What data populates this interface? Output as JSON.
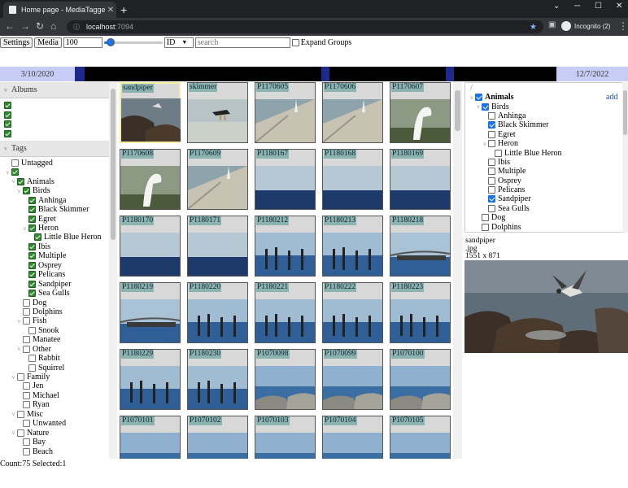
{
  "browser": {
    "tab_title": "Home page - MediaTagger",
    "new_tab": "+",
    "close_tab": "✕",
    "url_host": "localhost",
    "url_port": ":7094",
    "profile": "Incognito (2)",
    "win_min": "─",
    "win_max": "☐",
    "win_close": "✕",
    "win_chevron": "⌄"
  },
  "controls": {
    "settings_label": "Settings",
    "media_label": "Media",
    "size_value": "100",
    "slider_level": 0.1,
    "sort_value": "ID",
    "search_placeholder": "search",
    "expand_groups_label": "Expand Groups"
  },
  "timeline": {
    "start_date": "3/10/2020",
    "end_date": "12/7/2022"
  },
  "albums": {
    "title": "Albums",
    "count": 4
  },
  "tags": {
    "title": "Tags",
    "items": [
      {
        "label": "Untagged",
        "level": 0,
        "box": "empty",
        "twisty": ""
      },
      {
        "label": "",
        "level": 0,
        "box": "green",
        "twisty": "v"
      },
      {
        "label": "Animals",
        "level": 1,
        "box": "green",
        "twisty": "v"
      },
      {
        "label": "Birds",
        "level": 2,
        "box": "green",
        "twisty": "v"
      },
      {
        "label": "Anhinga",
        "level": 3,
        "box": "green",
        "twisty": ""
      },
      {
        "label": "Black Skimmer",
        "level": 3,
        "box": "green",
        "twisty": ""
      },
      {
        "label": "Egret",
        "level": 3,
        "box": "green",
        "twisty": ""
      },
      {
        "label": "Heron",
        "level": 3,
        "box": "green",
        "twisty": "v"
      },
      {
        "label": "Little Blue Heron",
        "level": 4,
        "box": "green",
        "twisty": ""
      },
      {
        "label": "Ibis",
        "level": 3,
        "box": "green",
        "twisty": ""
      },
      {
        "label": "Multiple",
        "level": 3,
        "box": "green",
        "twisty": ""
      },
      {
        "label": "Osprey",
        "level": 3,
        "box": "green",
        "twisty": ""
      },
      {
        "label": "Pelicans",
        "level": 3,
        "box": "green",
        "twisty": ""
      },
      {
        "label": "Sandpiper",
        "level": 3,
        "box": "green",
        "twisty": ""
      },
      {
        "label": "Sea Gulls",
        "level": 3,
        "box": "green",
        "twisty": ""
      },
      {
        "label": "Dog",
        "level": 2,
        "box": "empty",
        "twisty": ""
      },
      {
        "label": "Dolphins",
        "level": 2,
        "box": "empty",
        "twisty": ""
      },
      {
        "label": "Fish",
        "level": 2,
        "box": "empty",
        "twisty": "v"
      },
      {
        "label": "Snook",
        "level": 3,
        "box": "empty",
        "twisty": ""
      },
      {
        "label": "Manatee",
        "level": 2,
        "box": "empty",
        "twisty": ""
      },
      {
        "label": "Other",
        "level": 2,
        "box": "empty",
        "twisty": "v"
      },
      {
        "label": "Rabbit",
        "level": 3,
        "box": "empty",
        "twisty": ""
      },
      {
        "label": "Squirrel",
        "level": 3,
        "box": "empty",
        "twisty": ""
      },
      {
        "label": "Family",
        "level": 1,
        "box": "empty",
        "twisty": "v"
      },
      {
        "label": "Jen",
        "level": 2,
        "box": "empty",
        "twisty": ""
      },
      {
        "label": "Michael",
        "level": 2,
        "box": "empty",
        "twisty": ""
      },
      {
        "label": "Ryan",
        "level": 2,
        "box": "empty",
        "twisty": ""
      },
      {
        "label": "Misc",
        "level": 1,
        "box": "empty",
        "twisty": "v"
      },
      {
        "label": "Unwanted",
        "level": 2,
        "box": "empty",
        "twisty": ""
      },
      {
        "label": "Nature",
        "level": 1,
        "box": "empty",
        "twisty": "v"
      },
      {
        "label": "Bay",
        "level": 2,
        "box": "empty",
        "twisty": ""
      },
      {
        "label": "Beach",
        "level": 2,
        "box": "empty",
        "twisty": ""
      }
    ]
  },
  "thumbnails": [
    {
      "label": "sandpiper",
      "scene": "rocks",
      "selected": true
    },
    {
      "label": "skimmer",
      "scene": "sand",
      "selected": false
    },
    {
      "label": "P1170605",
      "scene": "wall",
      "selected": false
    },
    {
      "label": "P1170606",
      "scene": "wall",
      "selected": false
    },
    {
      "label": "P1170607",
      "scene": "egret",
      "selected": false
    },
    {
      "label": "P1170608",
      "scene": "egret",
      "selected": false
    },
    {
      "label": "P1170609",
      "scene": "wall",
      "selected": false
    },
    {
      "label": "P1180167",
      "scene": "sea",
      "selected": false
    },
    {
      "label": "P1180168",
      "scene": "sea",
      "selected": false
    },
    {
      "label": "P1180169",
      "scene": "sea",
      "selected": false
    },
    {
      "label": "P1180170",
      "scene": "sea",
      "selected": false
    },
    {
      "label": "P1180171",
      "scene": "sea",
      "selected": false
    },
    {
      "label": "P1180212",
      "scene": "pilings",
      "selected": false
    },
    {
      "label": "P1180213",
      "scene": "pilings",
      "selected": false
    },
    {
      "label": "P1180218",
      "scene": "bridge",
      "selected": false
    },
    {
      "label": "P1180219",
      "scene": "bridge",
      "selected": false
    },
    {
      "label": "P1180220",
      "scene": "pilings",
      "selected": false
    },
    {
      "label": "P1180221",
      "scene": "pilings",
      "selected": false
    },
    {
      "label": "P1180222",
      "scene": "pilings",
      "selected": false
    },
    {
      "label": "P1180223",
      "scene": "pilings",
      "selected": false
    },
    {
      "label": "P1180229",
      "scene": "pilings",
      "selected": false
    },
    {
      "label": "P1180230",
      "scene": "pilings",
      "selected": false
    },
    {
      "label": "P1070098",
      "scene": "rocksea",
      "selected": false
    },
    {
      "label": "P1070099",
      "scene": "rocksea",
      "selected": false
    },
    {
      "label": "P1070100",
      "scene": "rocksea",
      "selected": false
    },
    {
      "label": "P1070101",
      "scene": "rocksea",
      "selected": false
    },
    {
      "label": "P1070102",
      "scene": "rocksea",
      "selected": false
    },
    {
      "label": "P1070103",
      "scene": "rocksea",
      "selected": false
    },
    {
      "label": "P1070104",
      "scene": "rocksea",
      "selected": false
    },
    {
      "label": "P1070105",
      "scene": "rocksea",
      "selected": false
    }
  ],
  "tag_tree": {
    "root": "/",
    "add_label": "add",
    "items": [
      {
        "label": "Animals",
        "level": 0,
        "checked": true,
        "twisty": "v",
        "bold": true
      },
      {
        "label": "Birds",
        "level": 1,
        "checked": true,
        "twisty": "v",
        "bold": false
      },
      {
        "label": "Anhinga",
        "level": 2,
        "checked": false,
        "twisty": "",
        "bold": false
      },
      {
        "label": "Black Skimmer",
        "level": 2,
        "checked": true,
        "twisty": "",
        "bold": false
      },
      {
        "label": "Egret",
        "level": 2,
        "checked": false,
        "twisty": "",
        "bold": false
      },
      {
        "label": "Heron",
        "level": 2,
        "checked": false,
        "twisty": "v",
        "bold": false
      },
      {
        "label": "Little Blue Heron",
        "level": 3,
        "checked": false,
        "twisty": "",
        "bold": false
      },
      {
        "label": "Ibis",
        "level": 2,
        "checked": false,
        "twisty": "",
        "bold": false
      },
      {
        "label": "Multiple",
        "level": 2,
        "checked": false,
        "twisty": "",
        "bold": false
      },
      {
        "label": "Osprey",
        "level": 2,
        "checked": false,
        "twisty": "",
        "bold": false
      },
      {
        "label": "Pelicans",
        "level": 2,
        "checked": false,
        "twisty": "",
        "bold": false
      },
      {
        "label": "Sandpiper",
        "level": 2,
        "checked": true,
        "twisty": "",
        "bold": false
      },
      {
        "label": "Sea Gulls",
        "level": 2,
        "checked": false,
        "twisty": "",
        "bold": false
      },
      {
        "label": "Dog",
        "level": 1,
        "checked": false,
        "twisty": "",
        "bold": false
      },
      {
        "label": "Dolphins",
        "level": 1,
        "checked": false,
        "twisty": "",
        "bold": false
      }
    ]
  },
  "detail": {
    "name": "sandpiper",
    "ext": ".jpg",
    "dims": "1551 x 871"
  },
  "status": {
    "text": "Count:75 Selected:1"
  },
  "colors": {
    "label_bg": "#8bb3b0",
    "check_green": "#2f8a2f",
    "timeline_date_bg": "#c8cdf5",
    "timeline_mark": "#1d2a8c"
  }
}
